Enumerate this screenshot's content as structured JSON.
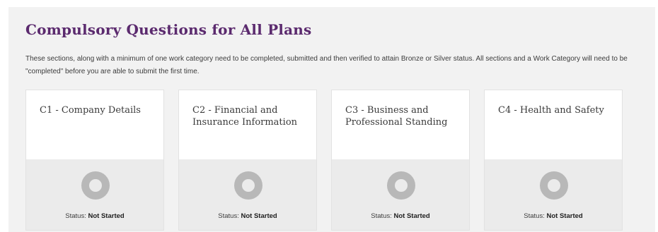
{
  "section": {
    "title": "Compulsory Questions for All Plans",
    "intro": "These sections, along with a minimum of one work category need to be completed, submitted and then verified to attain Bronze or Silver status. All sections and a Work Category will need to be \"completed\" before you are able to submit the first time."
  },
  "cards": [
    {
      "title": "C1 - Company Details",
      "status_label": "Status: ",
      "status_value": "Not Started"
    },
    {
      "title": "C2 - Financial and Insurance Information",
      "status_label": "Status: ",
      "status_value": "Not Started"
    },
    {
      "title": "C3 - Business and Professional Standing",
      "status_label": "Status: ",
      "status_value": "Not Started"
    },
    {
      "title": "C4 - Health and Safety",
      "status_label": "Status: ",
      "status_value": "Not Started"
    }
  ],
  "colors": {
    "title": "#5b2a6e",
    "panel_bg": "#f2f2f2",
    "status_ring": "#b8b8b8"
  },
  "icons": {
    "status": "ring-status-icon"
  }
}
